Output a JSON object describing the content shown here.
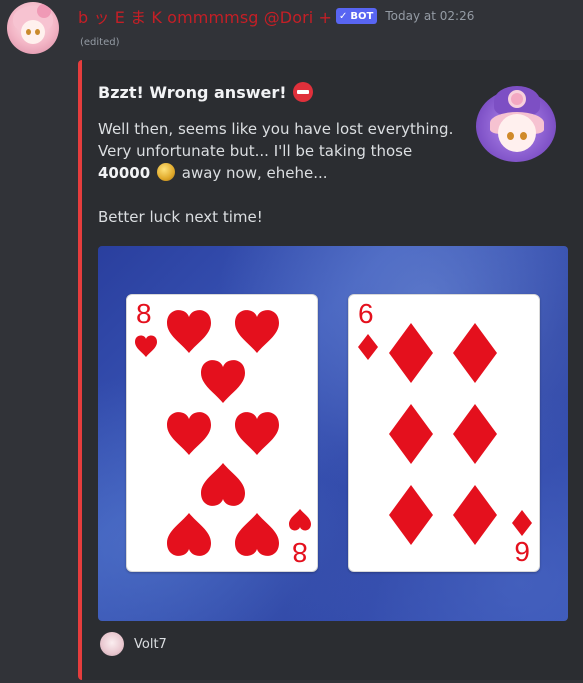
{
  "message": {
    "username": "b ッ E ま K ommmmsg @Dori +",
    "bot_tag": "BOT",
    "bot_check": "✓",
    "timestamp": "Today at 02:26",
    "edited": "(edited)"
  },
  "embed": {
    "accent_color": "#e53d3d",
    "title": "Bzzt! Wrong answer!",
    "description": {
      "line1": "Well then, seems like you have lost everything.",
      "line2": "Very unfortunate but... I'll be taking those",
      "amount": "40000",
      "line3_rest": "away now, ehehe...",
      "line4": "Better luck next time!"
    },
    "cards": [
      {
        "rank": "8",
        "suit": "hearts",
        "rank_bottom": "8"
      },
      {
        "rank": "6",
        "suit": "diamonds",
        "rank_bottom": "9"
      }
    ],
    "footer": {
      "text": "Volt7"
    }
  },
  "colors": {
    "background": "#313338",
    "embed_bg": "#2b2d31",
    "username": "#c41f26",
    "bot_tag": "#5865f2",
    "card_red": "#e4101d"
  },
  "icons": {
    "title_icon": "no-entry-icon",
    "coin_icon": "coin-icon"
  }
}
